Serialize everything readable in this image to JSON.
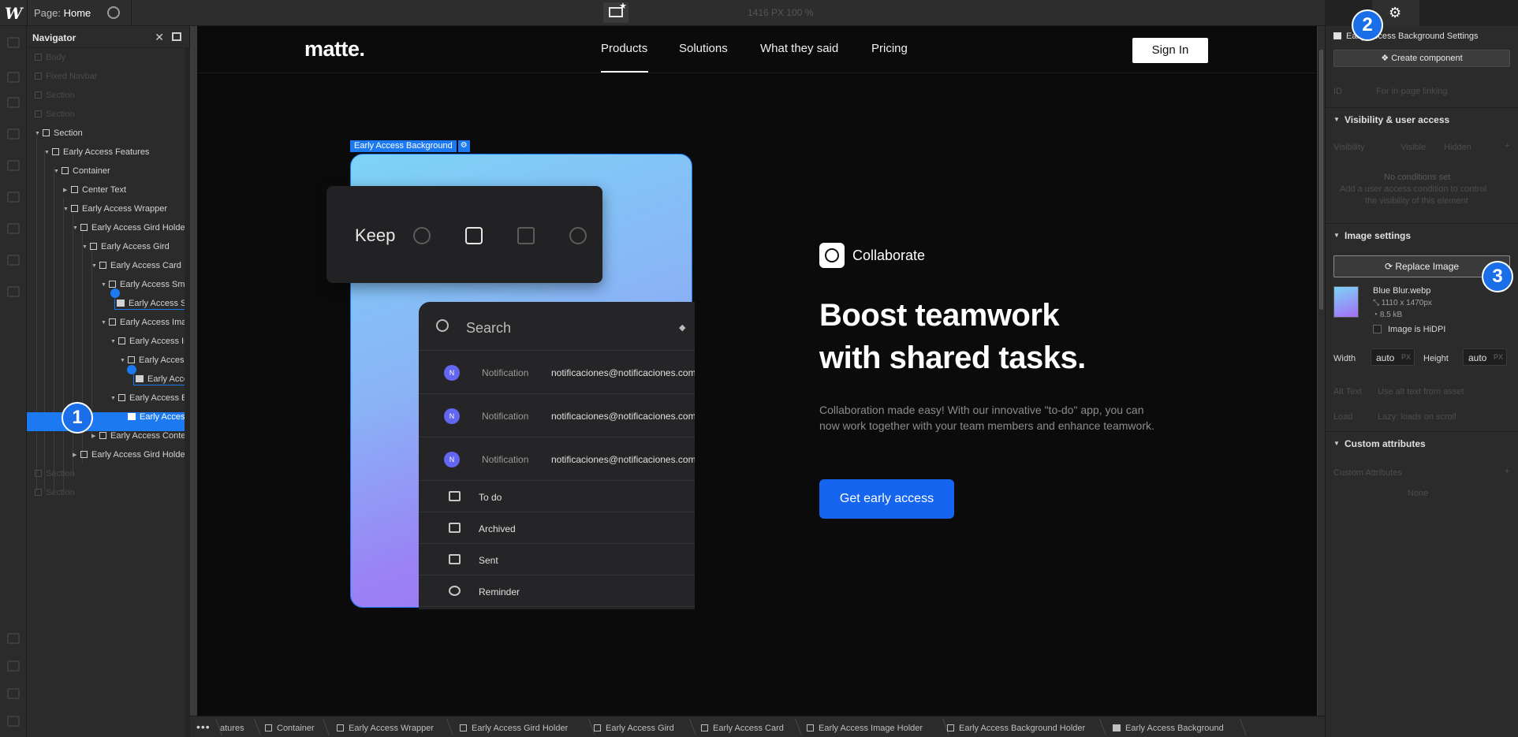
{
  "topbar": {
    "page_prefix": "Page:",
    "page_name": "Home",
    "dimensions": "1416 PX  100 %"
  },
  "navigator": {
    "title": "Navigator",
    "rows": [
      {
        "label": "Body",
        "dim": true
      },
      {
        "label": "Fixed Navbar",
        "dim": true
      },
      {
        "label": "Section",
        "dim": true
      },
      {
        "label": "Section",
        "dim": true
      },
      {
        "label": "Section"
      },
      {
        "label": "Early Access Features"
      },
      {
        "label": "Container"
      },
      {
        "label": "Center Text"
      },
      {
        "label": "Early Access Wrapper"
      },
      {
        "label": "Early Access Gird Holder"
      },
      {
        "label": "Early Access Gird"
      },
      {
        "label": "Early Access Card"
      },
      {
        "label": "Early Access Small"
      },
      {
        "label": "Early Access Small Image"
      },
      {
        "label": "Early Access Image Holder"
      },
      {
        "label": "Early Access Image"
      },
      {
        "label": "Early Access"
      },
      {
        "label": "Early Access"
      },
      {
        "label": "Early Access Background Holder"
      },
      {
        "label": "Early Access Background"
      },
      {
        "label": "Early Access Content"
      },
      {
        "label": "Early Access Gird Holder"
      },
      {
        "label": "Section",
        "dim": true
      },
      {
        "label": "Section",
        "dim": true
      }
    ]
  },
  "site": {
    "logo": "matte.",
    "menu": [
      "Products",
      "Solutions",
      "What they said",
      "Pricing"
    ],
    "signin": "Sign In",
    "selection_label": "Early Access Background",
    "keep_label": "Keep",
    "search_placeholder": "Search",
    "notifications": [
      {
        "initial": "N",
        "type": "Notification",
        "email": "notificaciones@notificaciones.com"
      },
      {
        "initial": "N",
        "type": "Notification",
        "email": "notificaciones@notificaciones.com"
      },
      {
        "initial": "N",
        "type": "Notification",
        "email": "notificaciones@notificaciones.com"
      }
    ],
    "folders": [
      "To do",
      "Archived",
      "Sent",
      "Reminder"
    ],
    "tag": "Collaborate",
    "headline_1": "Boost teamwork",
    "headline_2": "with shared tasks.",
    "paragraph": "Collaboration made easy! With our innovative \"to-do\" app, you can now work together with your team members and enhance teamwork.",
    "cta": "Get early access"
  },
  "breadcrumbs": [
    "atures",
    "Container",
    "Early Access Wrapper",
    "Early Access Gird Holder",
    "Early Access Gird",
    "Early Access Card",
    "Early Access Image Holder",
    "Early Access Background Holder",
    "Early Access Background"
  ],
  "panel": {
    "title": "Early Access Background Settings",
    "create_component": "Create component",
    "id_label": "ID",
    "id_placeholder": "For in-page linking",
    "visibility_section": "Visibility & user access",
    "visibility_label": "Visibility",
    "visible": "Visible",
    "hidden": "Hidden",
    "no_conditions": "No conditions set",
    "conditions_hint_1": "Add a user access condition to control",
    "conditions_hint_2": "the visibility of this element",
    "image_section": "Image settings",
    "replace_image": "Replace Image",
    "file_name": "Blue Blur.webp",
    "file_dims": "1110 x 1470px",
    "file_size": "8.5 kB",
    "hidpi": "Image is HiDPI",
    "width_label": "Width",
    "width_value": "auto",
    "height_label": "Height",
    "height_value": "auto",
    "unit": "PX",
    "alt_label": "Alt Text",
    "alt_value": "Use alt text from asset",
    "load_label": "Load",
    "load_value": "Lazy: loads on scroll",
    "custom_section": "Custom attributes",
    "custom_label": "Custom Attributes",
    "custom_none": "None"
  },
  "markers": [
    "1",
    "2",
    "3"
  ]
}
